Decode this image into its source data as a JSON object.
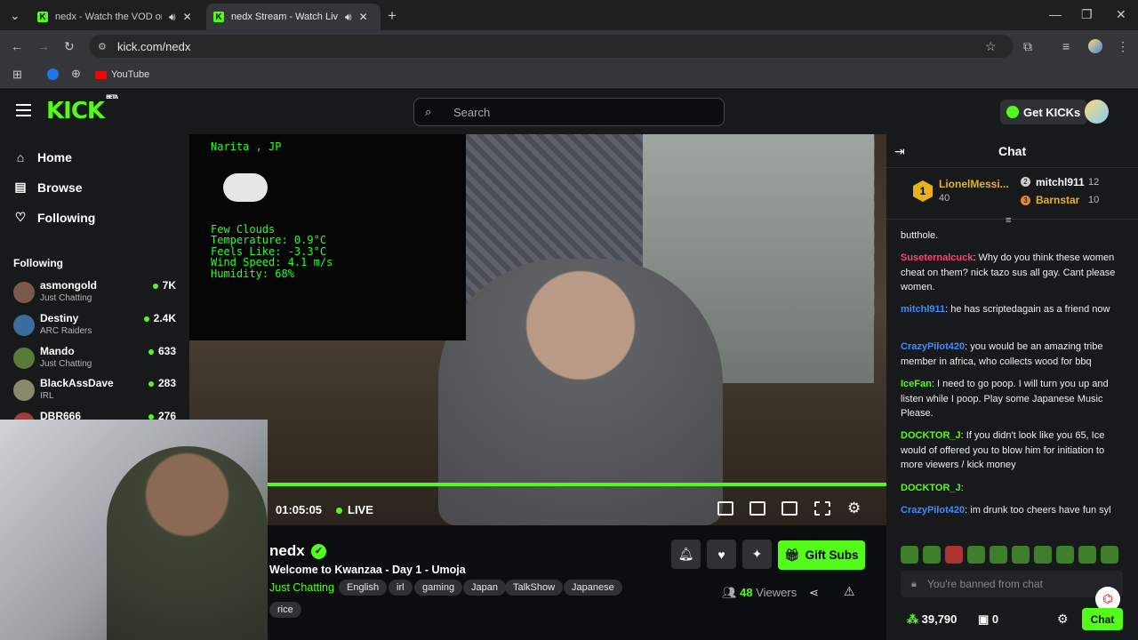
{
  "browser": {
    "tabs": [
      {
        "title": "nedx - Watch the VOD on K",
        "active": false
      },
      {
        "title": "nedx Stream - Watch Live o",
        "active": true
      }
    ],
    "url": "kick.com/nedx",
    "bookmarks": [
      {
        "label": "YouTube"
      }
    ]
  },
  "header": {
    "logo": "KICK",
    "logo_badge": "BETA",
    "search_placeholder": "Search",
    "get_kicks": "Get KICKs"
  },
  "sidebar": {
    "nav": [
      {
        "label": "Home"
      },
      {
        "label": "Browse"
      },
      {
        "label": "Following"
      }
    ],
    "following_heading": "Following",
    "following": [
      {
        "name": "asmongold",
        "category": "Just Chatting",
        "viewers": "7K",
        "avatar_color": "#7a5a4a"
      },
      {
        "name": "Destiny",
        "category": "ARC Raiders",
        "viewers": "2.4K",
        "avatar_color": "#3a6d9c"
      },
      {
        "name": "Mando",
        "category": "Just Chatting",
        "viewers": "633",
        "avatar_color": "#5a7a3a"
      },
      {
        "name": "BlackAssDave",
        "category": "IRL",
        "viewers": "283",
        "avatar_color": "#8a8a6a"
      },
      {
        "name": "DBR666",
        "category": "",
        "viewers": "276",
        "avatar_color": "#aa3a3a"
      }
    ]
  },
  "player": {
    "weather": {
      "location": "Narita , JP",
      "condition": "Few Clouds",
      "temperature": "Temperature: 0.9°C",
      "feels_like": "Feels Like: -3.3°C",
      "wind": "Wind Speed: 4.1 m/s",
      "humidity": "Humidity: 68%"
    },
    "time": "01:05:05",
    "live": "LIVE"
  },
  "stream": {
    "channel": "nedx",
    "title": "Welcome to Kwanzaa - Day 1 - Umoja",
    "category": "Just Chatting",
    "tags": [
      "English",
      "irl",
      "gaming",
      "Japan",
      "TalkShow",
      "Japanese",
      "rice"
    ],
    "gift_subs": "Gift Subs",
    "viewers_count": "48",
    "viewers_label": "Viewers"
  },
  "chat": {
    "title": "Chat",
    "leaderboard": [
      {
        "name": "LionelMessi...",
        "value": "40",
        "rank": "1"
      },
      {
        "name": "mitchl911",
        "value": "12",
        "rank": "2"
      },
      {
        "name": "Barnstar",
        "value": "10",
        "rank": "3"
      }
    ],
    "messages": [
      {
        "user": "",
        "text": "butthole.",
        "color": "#eeeeee"
      },
      {
        "user": "Suseternalcuck",
        "text": ": Why do you think these women cheat on them? nick tazo sus all gay. Cant please women.",
        "color": "#ff3f7a"
      },
      {
        "user": "mitchl911",
        "text": ": he has scriptedagain as a friend now",
        "color": "#3f8cff"
      },
      {
        "user": "CrazyPilot420",
        "text": ": you would be an amazing tribe member in africa, who collects wood for bbq",
        "color": "#3f8cff"
      },
      {
        "user": "IceFan",
        "text": ": I need to go poop. I will turn you up and listen while I poop. Play some Japanese Music Please.",
        "color": "#53fc18"
      },
      {
        "user": "DOCKTOR_J",
        "text": ": If you didn't look like you 65, Ice would of offered you to blow him for initiation to more viewers / kick money",
        "color": "#53fc18"
      },
      {
        "user": "DOCKTOR_J",
        "text": ":",
        "color": "#53fc18"
      },
      {
        "user": "CrazyPilot420",
        "text": ": im drunk too cheers have fun syl",
        "color": "#3f8cff"
      }
    ],
    "banned_placeholder": "You're banned from chat",
    "points": "39,790",
    "drops": "0",
    "send_label": "Chat"
  }
}
